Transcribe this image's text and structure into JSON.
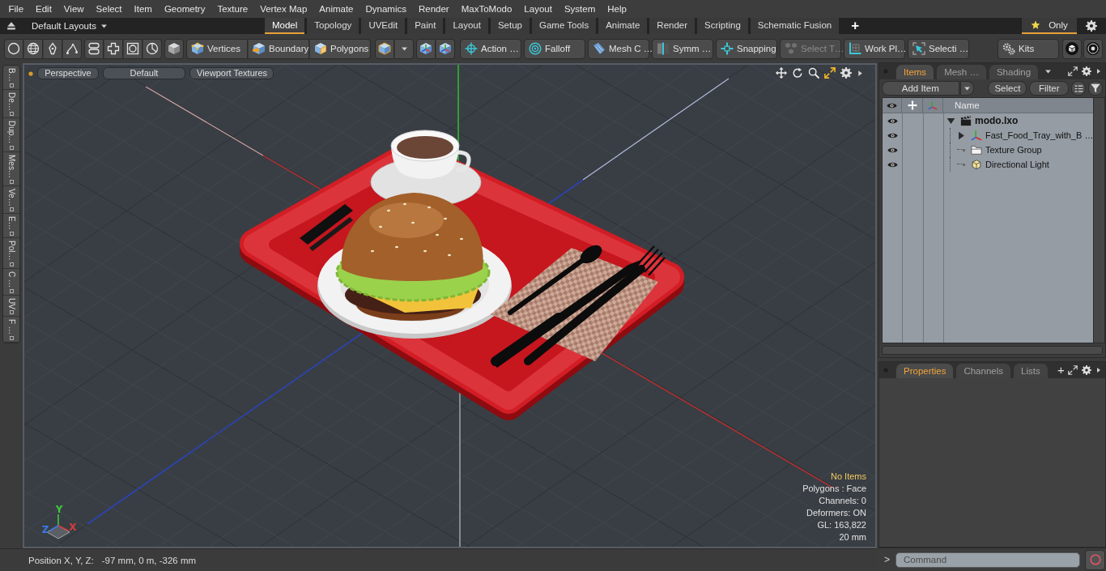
{
  "menu_bar": {
    "items": [
      "File",
      "Edit",
      "View",
      "Select",
      "Item",
      "Geometry",
      "Texture",
      "Vertex Map",
      "Animate",
      "Dynamics",
      "Render",
      "MaxToModo",
      "Layout",
      "System",
      "Help"
    ]
  },
  "layout_bar": {
    "layouts_menu": "Default Layouts",
    "tabs": [
      {
        "label": "Model",
        "selected": true
      },
      {
        "label": "Topology",
        "selected": false
      },
      {
        "label": "UVEdit",
        "selected": false
      },
      {
        "label": "Paint",
        "selected": false
      },
      {
        "label": "Layout",
        "selected": false
      },
      {
        "label": "Setup",
        "selected": false
      },
      {
        "label": "Game Tools",
        "selected": false
      },
      {
        "label": "Animate",
        "selected": false
      },
      {
        "label": "Render",
        "selected": false
      },
      {
        "label": "Scripting",
        "selected": false
      },
      {
        "label": "Schematic Fusion",
        "selected": false
      }
    ],
    "add_tab": "+",
    "favorites": {
      "label": "Only",
      "active": true
    }
  },
  "toolbar": {
    "selection_modes": [
      {
        "label": "Vertices"
      },
      {
        "label": "Boundary"
      },
      {
        "label": "Polygons"
      }
    ],
    "tools": [
      {
        "label": "Action …",
        "disabled": false
      },
      {
        "label": "Falloff",
        "disabled": false
      },
      {
        "label": "Mesh C …",
        "disabled": false
      },
      {
        "label": "Symm …",
        "disabled": false
      },
      {
        "label": "Snapping",
        "disabled": false
      },
      {
        "label": "Select T…",
        "disabled": true
      },
      {
        "label": "Work Pl…",
        "disabled": false
      },
      {
        "label": "Selecti …",
        "disabled": false
      }
    ],
    "kits": "Kits"
  },
  "side_tabs": [
    "B…",
    "De…",
    "Dup…",
    "Mes…",
    "Ve…",
    "E…",
    "Pol…",
    "C …",
    "UV",
    "F …"
  ],
  "viewport": {
    "view_buttons": [
      "Perspective",
      "Default",
      "Viewport Textures"
    ],
    "info": [
      {
        "text": "No Items",
        "highlighted": true
      },
      {
        "text": "Polygons : Face",
        "highlighted": false
      },
      {
        "text": "Channels: 0",
        "highlighted": false
      },
      {
        "text": "Deformers: ON",
        "highlighted": false
      },
      {
        "text": "GL: 163,822",
        "highlighted": false
      },
      {
        "text": "20 mm",
        "highlighted": false
      }
    ],
    "axis_gizmo": [
      {
        "label": "Y",
        "color": "#3ec83e"
      },
      {
        "label": "Z",
        "color": "#3c78e6"
      },
      {
        "label": "X",
        "color": "#d83c3c"
      }
    ]
  },
  "status_bar": {
    "label": "Position X, Y, Z:",
    "value": "-97 mm, 0 m, -326 mm"
  },
  "items_panel": {
    "tabs": [
      {
        "label": "Items",
        "selected": true
      },
      {
        "label": "Mesh …",
        "selected": false
      },
      {
        "label": "Shading",
        "selected": false
      }
    ],
    "add_button": "Add Item",
    "buttons": [
      "Select",
      "Filter"
    ],
    "name_column": "Name",
    "tree": [
      {
        "name": "modo.lxo",
        "kind": "scene",
        "visible": true,
        "expanded": true,
        "children": [
          {
            "name": "Fast_Food_Tray_with_B …",
            "kind": "mesh",
            "visible": true,
            "expanded": false
          },
          {
            "name": "Texture Group",
            "kind": "group",
            "visible": true
          },
          {
            "name": "Directional Light",
            "kind": "light",
            "visible": true
          }
        ]
      }
    ]
  },
  "properties_panel": {
    "tabs": [
      {
        "label": "Properties",
        "selected": true
      },
      {
        "label": "Channels",
        "selected": false
      },
      {
        "label": "Lists",
        "selected": false
      }
    ],
    "add_tab": "+"
  },
  "command_bar": {
    "prompt": ">",
    "placeholder": "Command"
  }
}
